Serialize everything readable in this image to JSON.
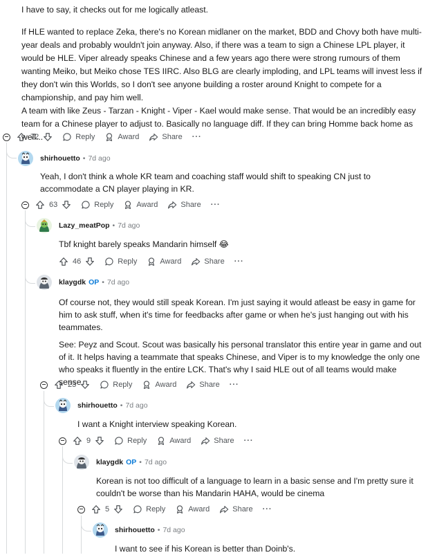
{
  "top_comment": {
    "p1": "I have to say, it checks out for me logically atleast.",
    "p2": "If HLE wanted to replace Zeka, there's no Korean midlaner on the market, BDD and Chovy both have multi-year deals and probably wouldn't join anyway. Also, if there was a team to sign a Chinese LPL player, it would be HLE. Viper already speaks Chinese and a few years ago there were strong rumours of them wanting Meiko, but Meiko chose TES IIRC. Also BLG are clearly imploding, and LPL teams will invest less if they don't win this Worlds, so I don't see anyone building a roster around Knight to compete for a championship, and pay him well.",
    "p3": "A team with like Zeus - Tarzan - Knight - Viper - Kael would make sense. That would be an incredibly easy team for a Chinese player to adjust to. Basically no language diff. If they can bring Homme back home as well...",
    "votes": "72"
  },
  "labels": {
    "reply": "Reply",
    "award": "Award",
    "share": "Share",
    "more": "···",
    "op": "OP",
    "dot": "•"
  },
  "comments": [
    {
      "user": "shirhouetto",
      "time": "7d ago",
      "op": false,
      "text": "Yeah, I don't think a whole KR team and coaching staff would shift to speaking CN just to accommodate a CN player playing in KR.",
      "votes": "63"
    },
    {
      "user": "Lazy_meatPop",
      "time": "7d ago",
      "op": false,
      "text": "Tbf knight barely speaks Mandarin himself 😂",
      "votes": "46"
    },
    {
      "user": "klaygdk",
      "time": "7d ago",
      "op": true,
      "text": "Of course not, they would still speak Korean. I'm just saying it would atleast be easy in game for him to ask stuff, when it's time for feedbacks after game or when he's just hanging out with his teammates.",
      "text2": "See: Peyz and Scout. Scout was basically his personal translator this entire year in game and out of it. It helps having a teammate that speaks Chinese, and Viper is to my knowledge the only one who speaks it fluently in the entire LCK. That's why I said HLE out of all teams would make sense.",
      "votes": "23"
    },
    {
      "user": "shirhouetto",
      "time": "7d ago",
      "op": false,
      "text": "I want a Knight interview speaking Korean.",
      "votes": "9"
    },
    {
      "user": "klaygdk",
      "time": "7d ago",
      "op": true,
      "text": "Korean is not too difficult of a language to learn in a basic sense and I'm pretty sure it couldn't be worse than his Mandarin HAHA, would be cinema",
      "votes": "5"
    },
    {
      "user": "shirhouetto",
      "time": "7d ago",
      "op": false,
      "text": "I want to see if his Korean is better than Doinb's."
    }
  ]
}
